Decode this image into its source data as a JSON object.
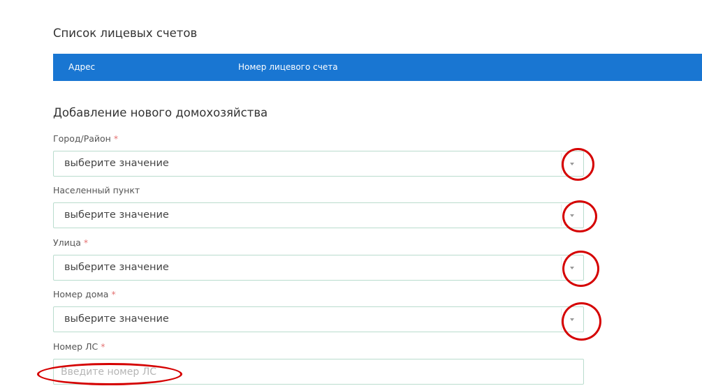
{
  "accounts_section": {
    "title": "Список лицевых счетов",
    "table": {
      "columns": [
        "Адрес",
        "Номер лицевого счета"
      ],
      "header_color": "#1976d2"
    }
  },
  "add_section": {
    "title": "Добавление нового домохозяйства",
    "required_mark": "*",
    "fields": [
      {
        "label": "Город/Район",
        "required": true,
        "type": "select",
        "value": "выберите значение"
      },
      {
        "label": "Населенный пункт",
        "required": false,
        "type": "select",
        "value": "выберите значение"
      },
      {
        "label": "Улица",
        "required": true,
        "type": "select",
        "value": "выберите значение"
      },
      {
        "label": "Номер дома",
        "required": true,
        "type": "select",
        "value": "выберите значение"
      },
      {
        "label": "Номер ЛС",
        "required": true,
        "type": "text",
        "value": "",
        "placeholder": "Введите номер ЛС"
      }
    ]
  },
  "annotations": {
    "color": "#d50000",
    "shape": "hand-drawn red circles around select dropdown arrows and input placeholder"
  }
}
